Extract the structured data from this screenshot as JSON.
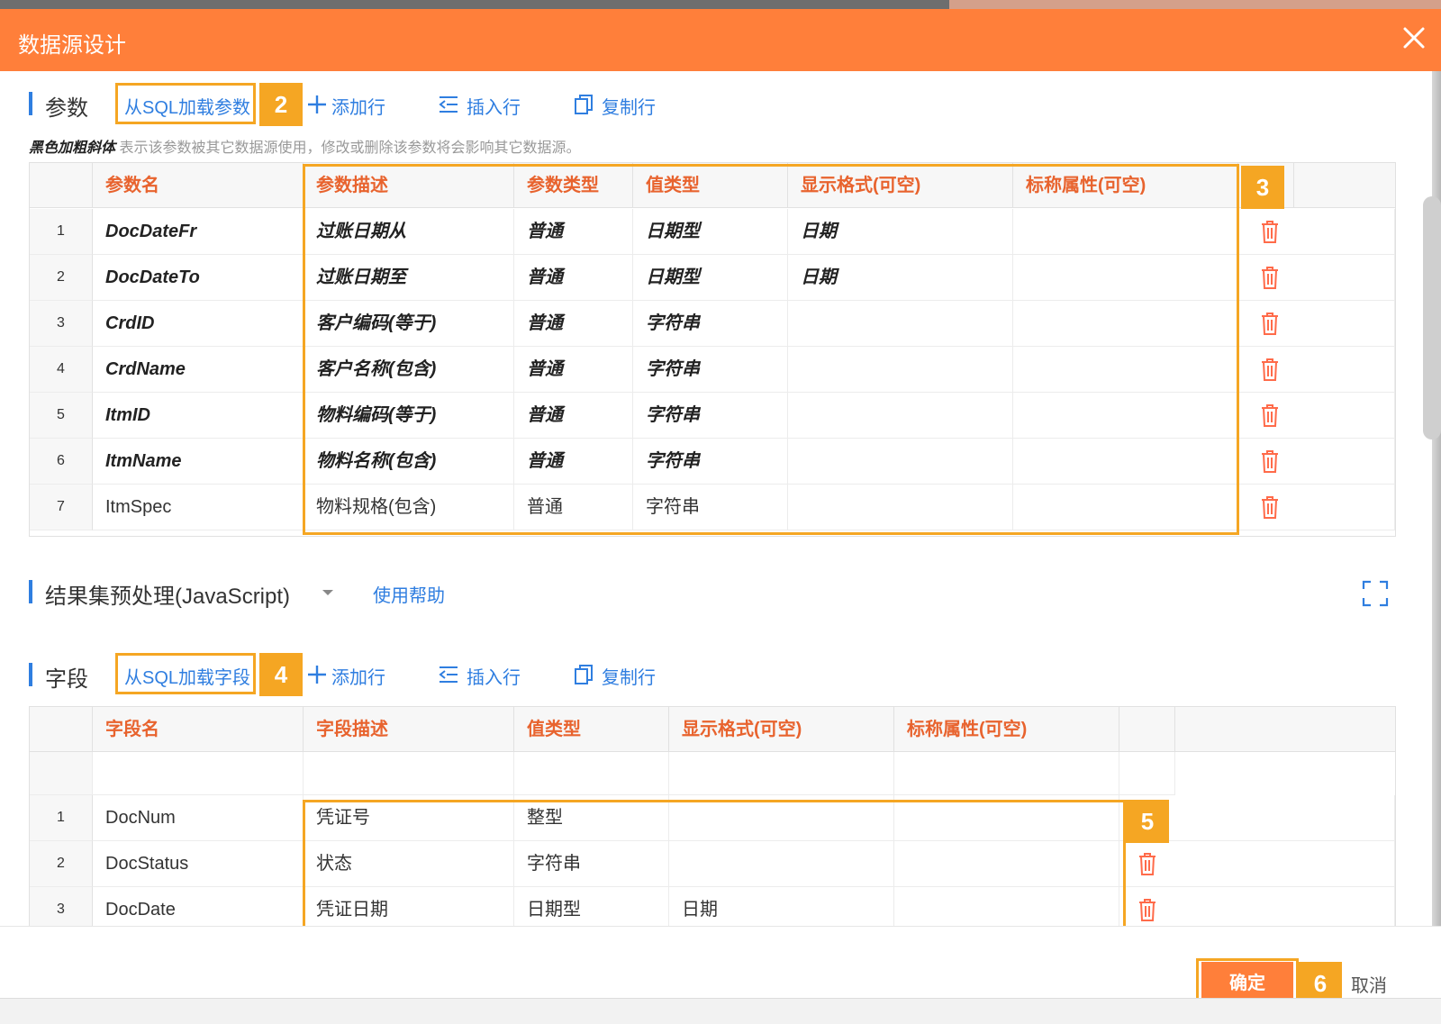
{
  "dialog": {
    "title": "数据源设计"
  },
  "params_section": {
    "title": "参数",
    "load_label": "从SQL加载参数",
    "add_row": "添加行",
    "insert_row": "插入行",
    "copy_row": "复制行",
    "note_bold": "黑色加粗斜体",
    "note_text": "表示该参数被其它数据源使用，修改或删除该参数将会影响其它数据源。",
    "headers": [
      "参数名",
      "参数描述",
      "参数类型",
      "值类型",
      "显示格式(可空)",
      "标称属性(可空)"
    ],
    "rows": [
      {
        "n": "1",
        "name": "DocDateFr",
        "desc": "过账日期从",
        "ptype": "普通",
        "vtype": "日期型",
        "fmt": "日期",
        "attr": ""
      },
      {
        "n": "2",
        "name": "DocDateTo",
        "desc": "过账日期至",
        "ptype": "普通",
        "vtype": "日期型",
        "fmt": "日期",
        "attr": ""
      },
      {
        "n": "3",
        "name": "CrdID",
        "desc": "客户编码(等于)",
        "ptype": "普通",
        "vtype": "字符串",
        "fmt": "",
        "attr": ""
      },
      {
        "n": "4",
        "name": "CrdName",
        "desc": "客户名称(包含)",
        "ptype": "普通",
        "vtype": "字符串",
        "fmt": "",
        "attr": ""
      },
      {
        "n": "5",
        "name": "ItmID",
        "desc": "物料编码(等于)",
        "ptype": "普通",
        "vtype": "字符串",
        "fmt": "",
        "attr": ""
      },
      {
        "n": "6",
        "name": "ItmName",
        "desc": "物料名称(包含)",
        "ptype": "普通",
        "vtype": "字符串",
        "fmt": "",
        "attr": ""
      },
      {
        "n": "7",
        "name": "ItmSpec",
        "desc": "物料规格(包含)",
        "ptype": "普通",
        "vtype": "字符串",
        "fmt": "",
        "attr": ""
      }
    ]
  },
  "js_section": {
    "title": "结果集预处理(JavaScript)",
    "help_label": "使用帮助"
  },
  "fields_section": {
    "title": "字段",
    "load_label": "从SQL加载字段",
    "add_row": "添加行",
    "insert_row": "插入行",
    "copy_row": "复制行",
    "headers": [
      "字段名",
      "字段描述",
      "值类型",
      "显示格式(可空)",
      "标称属性(可空)"
    ],
    "rows": [
      {
        "n": "1",
        "name": "DocNum",
        "desc": "凭证号",
        "vtype": "整型",
        "fmt": "",
        "attr": ""
      },
      {
        "n": "2",
        "name": "DocStatus",
        "desc": "状态",
        "vtype": "字符串",
        "fmt": "",
        "attr": ""
      },
      {
        "n": "3",
        "name": "DocDate",
        "desc": "凭证日期",
        "vtype": "日期型",
        "fmt": "日期",
        "attr": ""
      }
    ]
  },
  "footer": {
    "ok": "确定",
    "cancel": "取消"
  },
  "callouts": [
    "2",
    "3",
    "4",
    "5",
    "6"
  ],
  "colors": {
    "accent": "#ff7f3a",
    "link": "#2f7ee0",
    "highlight": "#f5a623",
    "header_text": "#e8632e"
  }
}
